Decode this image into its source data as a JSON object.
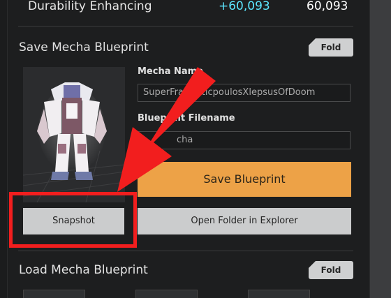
{
  "stat": {
    "label": "Durability Enhancing",
    "bonus": "+60,093",
    "value": "60,093"
  },
  "save_section": {
    "title": "Save Mecha Blueprint",
    "fold_label": "Fold",
    "mecha_name_label": "Mecha Name",
    "mecha_name_value": "SuperFragilisticpoulosXlepsusOfDoom",
    "filename_label": "Blueprint Filename",
    "filename_value": "cha",
    "save_button": "Save Blueprint",
    "snapshot_button": "Snapshot",
    "open_folder_button": "Open Folder in Explorer"
  },
  "load_section": {
    "title": "Load Mecha Blueprint",
    "fold_label": "Fold"
  },
  "colors": {
    "accent_orange": "#eda247",
    "bonus_cyan": "#5ce6ff",
    "annotation_red": "#f21e1e"
  }
}
